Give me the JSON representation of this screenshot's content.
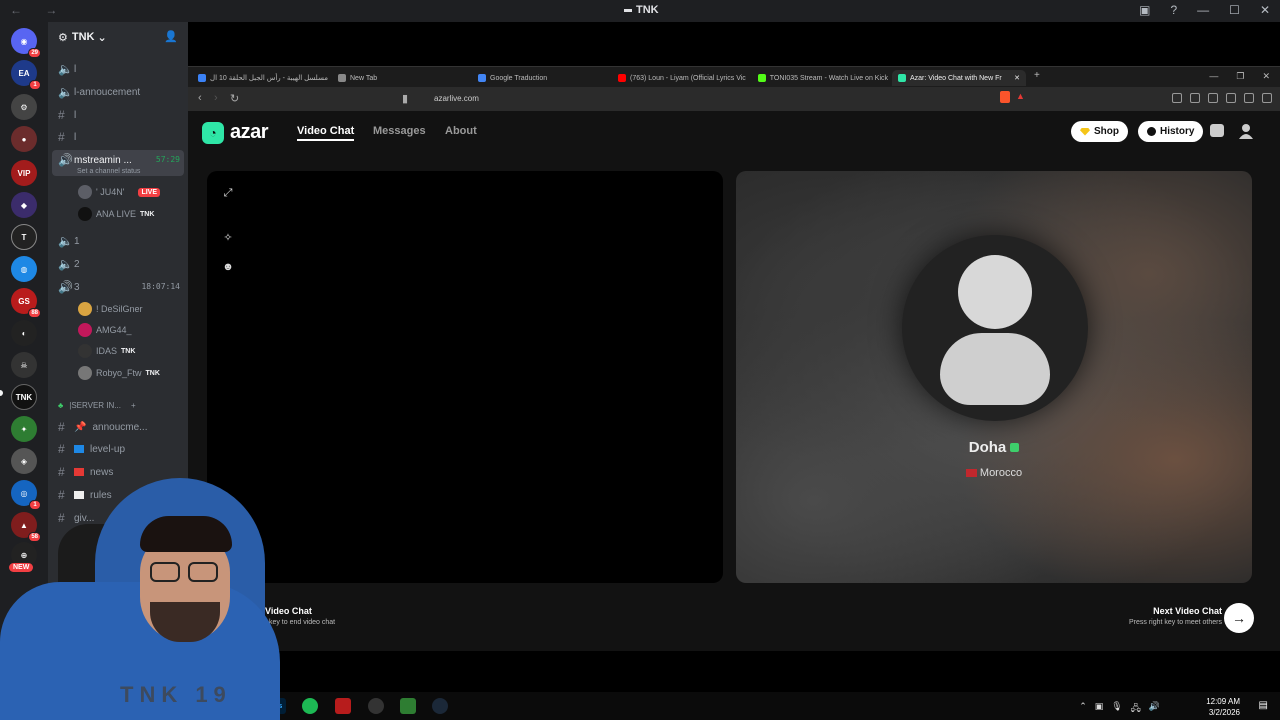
{
  "discord": {
    "window_title": "TNK",
    "server_name": "TNK",
    "channels": [
      {
        "type": "voice",
        "name": "l"
      },
      {
        "type": "voice",
        "name": "l-annoucement"
      },
      {
        "type": "text",
        "name": "l"
      },
      {
        "type": "text",
        "name": "l"
      }
    ],
    "active_voice": {
      "name": "mstreamin ...",
      "timer": "57:29",
      "status_hint": "Set a channel status",
      "members": [
        {
          "name": "' JU4N'",
          "badge": "LIVE"
        },
        {
          "name": "ANA LIVE",
          "tag": "TNK"
        }
      ]
    },
    "voice_channels": [
      "1",
      "2"
    ],
    "voice3": {
      "name": "3",
      "timer": "18:07:14",
      "members": [
        "! DeSilGner",
        "AMG44_",
        "IDAS",
        "Robyo_Ftw"
      ],
      "member_tags": [
        "",
        "",
        "TNK",
        "TNK"
      ]
    },
    "category": "|SERVER IN...",
    "text_channels": [
      {
        "name": "annoucme..."
      },
      {
        "name": "level-up"
      },
      {
        "name": "news"
      },
      {
        "name": "rules"
      },
      {
        "name": "giv..."
      }
    ],
    "rail_badges": [
      "29",
      "1",
      "88",
      "1",
      "58"
    ],
    "new_tag": "NEW"
  },
  "browser": {
    "tabs": [
      {
        "title": "مسلسل الهيبة - رأس الجبل الحلقة 10 ال",
        "color": "#3b82f6"
      },
      {
        "title": "New Tab",
        "color": "#888888"
      },
      {
        "title": "Google Traduction",
        "color": "#4285f4"
      },
      {
        "title": "(763) Loun - Liyam (Official Lyrics Vic",
        "color": "#ff0000"
      },
      {
        "title": "TONI035 Stream - Watch Live on Kick",
        "color": "#53fc18"
      },
      {
        "title": "Azar: Video Chat with New Fr",
        "color": "#2fe6a7"
      }
    ],
    "url": "azarlive.com"
  },
  "azar": {
    "logo_text": "azar",
    "nav": [
      "Video Chat",
      "Messages",
      "About"
    ],
    "shop_label": "Shop",
    "history_label": "History",
    "remote_name": "Doha",
    "remote_country": "Morocco",
    "footer_left_title": "l Video Chat",
    "footer_left_sub": "sc key to end video chat",
    "footer_right_title": "Next Video Chat",
    "footer_right_sub": "Press right key to meet others",
    "accent": "#2fe6a7"
  },
  "taskbar": {
    "time": "12:09 AM",
    "date": "3/2/2026",
    "apps": [
      "Ps",
      "Spotify",
      "Soundsurfer",
      "OBS",
      "Game",
      "Steam"
    ]
  },
  "webcam": {
    "print_text": "TNK 19"
  }
}
